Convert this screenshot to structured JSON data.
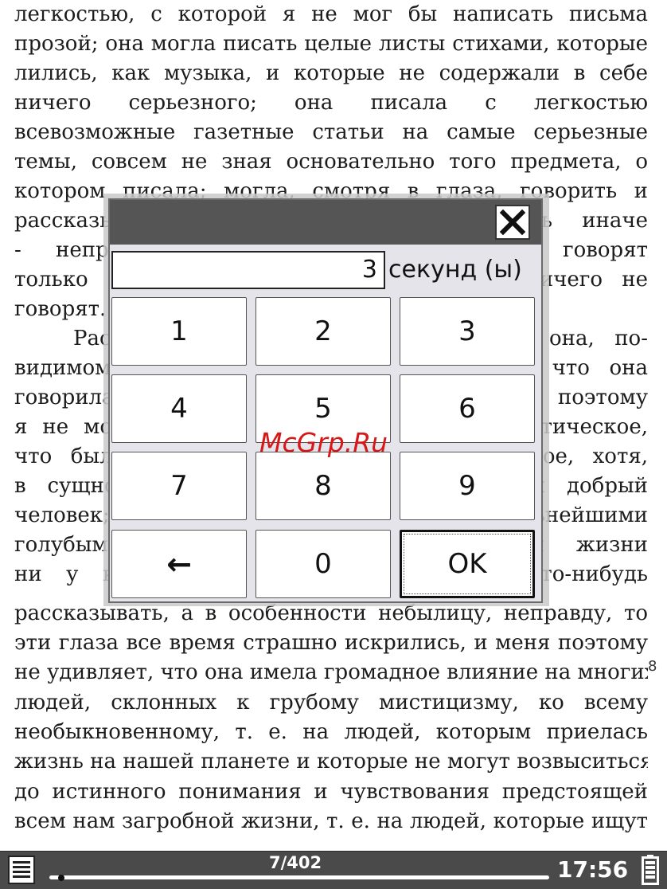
{
  "book": {
    "lines": [
      "легкостью, с которой я не мог бы написать письма",
      "прозой; она могла писать целые листы стихами, которые",
      "лились, как музыка, и которые не содержали в себе",
      "ничего серьезного; она писала с легкостью",
      "всевозможные газетные статьи на самые серьезные",
      "темы, совсем не зная основательно того предмета, о",
      "котором писала; могла, смотря в глаза, говорить и",
      "рассказывать вещи, которые, оказывались иначе",
      "- неправдой, которые люди, которые говорят",
      "только то, что они ничего не говорят, ничего не",
      "говорят.",
      "Рассказывала же она, как говорили, она, по-",
      "видимому, с такой непоколебимою верою, что она",
      "говорила святую правду, что просто поэтому",
      "я не могу не назвать ее ясновидящей, мистическое,",
      "что было в ней, было все же человеческое, хотя,",
      "в сущности, она была в высшей степени добрый",
      "человек; глаза у нее были замечательнейшими",
      "голубыми, и я не встречал в своей жизни",
      "ни у кого таких глаз, и когда она что-нибудь",
      "рассказывать, а в особенности небылицу, неправду, то",
      "эти глаза все время страшно искрились, и меня поэтому",
      "не удивляет, что она имела громадное влияние на многих",
      "людей, склонных к грубому мистицизму, ко всему",
      "необыкновенному, т. е. на людей, которым приелась",
      "жизнь на нашей планете и которые не могут возвыситься",
      "до истинного понимания и чувствования предстоящей",
      "всем нам загробной жизни, т. е. на людей, которые ищут"
    ],
    "footnote": "8"
  },
  "dialog": {
    "close_icon": "close-icon",
    "timer_value": "3",
    "timer_unit": "секунд (ы)",
    "keys": [
      "1",
      "2",
      "3",
      "4",
      "5",
      "6",
      "7",
      "8",
      "9",
      "←",
      "0",
      "OK"
    ]
  },
  "watermark": "McGrp.Ru",
  "status": {
    "page": "7/402",
    "time": "17:56",
    "reading_progress": 0.017,
    "menu_icon": "book-menu-icon",
    "battery_icon": "battery-icon"
  }
}
